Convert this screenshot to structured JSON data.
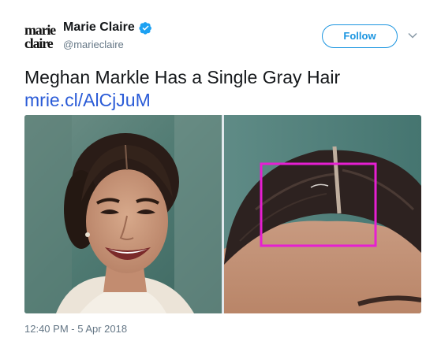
{
  "account": {
    "logo_line1": "marie",
    "logo_line2": "claire",
    "display_name": "Marie Claire",
    "handle": "@marieclaire",
    "verified_icon": "verified-badge-icon"
  },
  "actions": {
    "follow_label": "Follow",
    "menu_icon": "chevron-down-icon"
  },
  "tweet": {
    "text": "Meghan Markle Has a Single Gray Hair",
    "link": "mrie.cl/AlCjJuM",
    "timestamp": "12:40 PM - 5 Apr 2018"
  },
  "media": {
    "images": [
      {
        "subject": "smiling woman with dark hair pulled back"
      },
      {
        "subject": "close-up of hair parting with highlighted gray hair"
      }
    ],
    "highlight_color": "#e61fd2"
  },
  "colors": {
    "accent": "#1b95e0",
    "link": "#2a5bd7",
    "muted": "#657786",
    "text": "#14171a"
  }
}
